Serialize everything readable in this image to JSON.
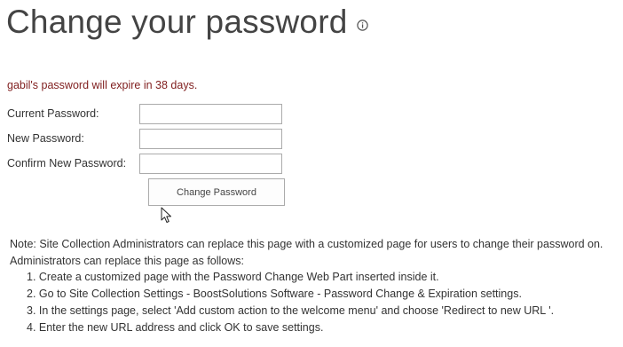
{
  "header": {
    "title": "Change your password",
    "info_icon": "info-circle-icon"
  },
  "status": {
    "expire_message": "gabil's password will expire in 38 days."
  },
  "form": {
    "current_password_label": "Current Password:",
    "current_password_value": "",
    "new_password_label": "New Password:",
    "new_password_value": "",
    "confirm_password_label": "Confirm New Password:",
    "confirm_password_value": "",
    "submit_label": "Change Password"
  },
  "note": {
    "line1": "Note: Site Collection Administrators can replace this page with a customized page for users to change their password on.",
    "line2": "Administrators can replace this page as follows:",
    "steps": [
      "1. Create a customized page with the Password Change Web Part inserted inside it.",
      "2. Go to Site Collection Settings - BoostSolutions Software - Password Change & Expiration settings.",
      "3. In the settings page, select 'Add custom action to the welcome menu' and choose 'Redirect to new URL '.",
      "4. Enter the new URL address and click OK to save settings."
    ]
  },
  "colors": {
    "expire_text": "#7f1d1d",
    "title_text": "#444444",
    "body_text": "#333333",
    "input_border": "#ababab"
  }
}
